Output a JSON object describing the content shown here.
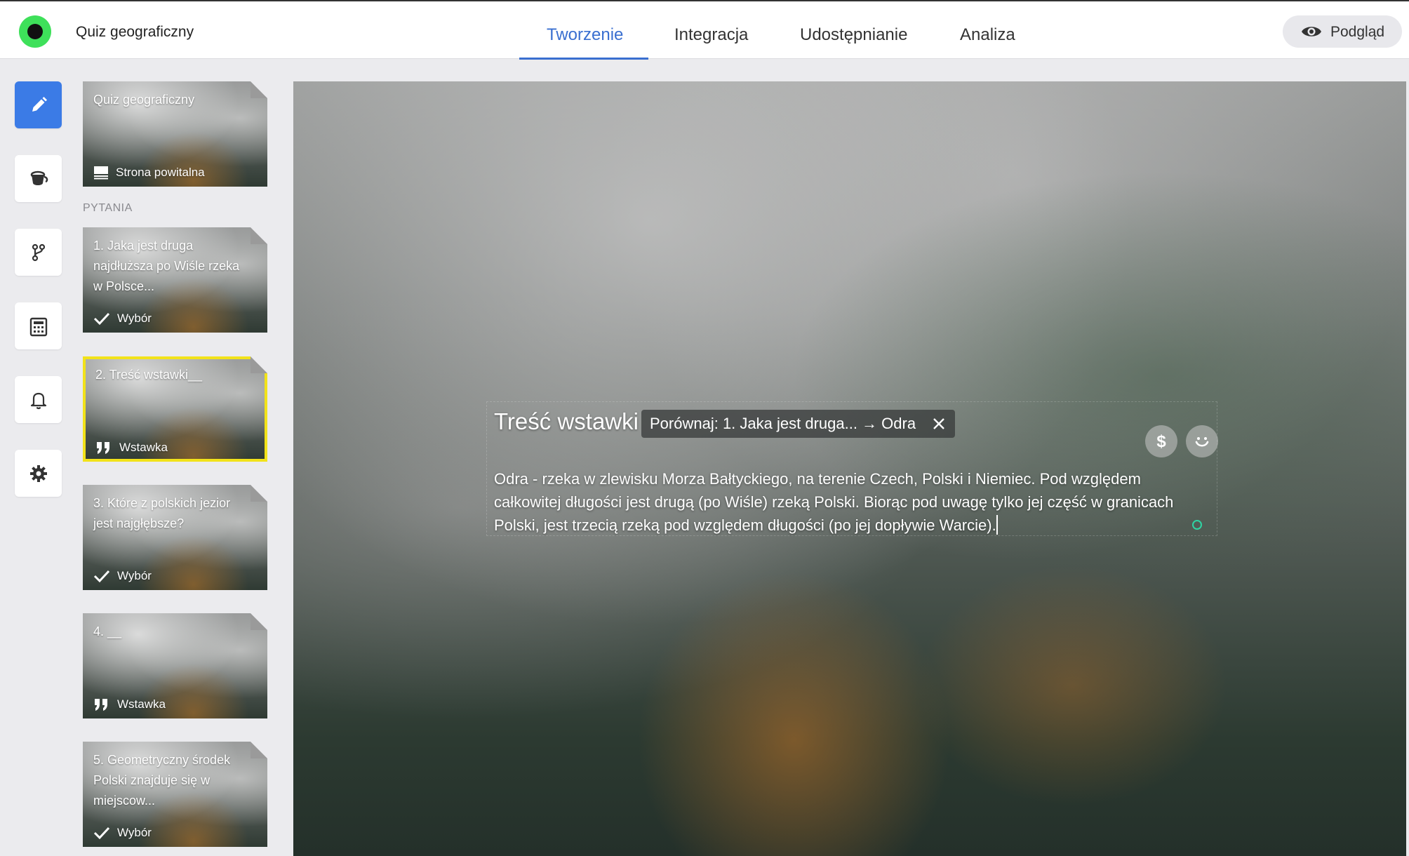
{
  "header": {
    "app_title": "Quiz geograficzny",
    "tabs": [
      {
        "label": "Tworzenie",
        "active": true
      },
      {
        "label": "Integracja",
        "active": false
      },
      {
        "label": "Udostępnianie",
        "active": false
      },
      {
        "label": "Analiza",
        "active": false
      }
    ],
    "preview_label": "Podgląd",
    "accent_color": "#3a6fd0"
  },
  "toolbar": {
    "tools": [
      {
        "icon": "pencil-icon",
        "active": true
      },
      {
        "icon": "paint-bucket-icon",
        "active": false
      },
      {
        "icon": "branch-icon",
        "active": false
      },
      {
        "icon": "calculator-icon",
        "active": false
      },
      {
        "icon": "bell-icon",
        "active": false
      },
      {
        "icon": "gear-icon",
        "active": false
      }
    ]
  },
  "slides": {
    "welcome": {
      "title": "Quiz geograficzny",
      "type": "Strona powitalna",
      "icon": "welcome-screen-icon"
    },
    "section_label": "PYTANIA",
    "items": [
      {
        "title": "1. Jaka jest druga najdłuższa po Wiśle rzeka w Polsce...",
        "type": "Wybór",
        "icon": "checkmark-icon",
        "selected": false
      },
      {
        "title": "2. Treść wstawki__",
        "type": "Wstawka",
        "icon": "quote-icon",
        "selected": true
      },
      {
        "title": "3. Które z polskich jezior jest najgłębsze?",
        "type": "Wybór",
        "icon": "checkmark-icon",
        "selected": false
      },
      {
        "title": "4. __",
        "type": "Wstawka",
        "icon": "quote-icon",
        "selected": false
      },
      {
        "title": "5. Geometryczny środek Polski znajduje się w miejscow...",
        "type": "Wybór",
        "icon": "checkmark-icon",
        "selected": false
      }
    ],
    "selected_outline_color": "#f2e21a"
  },
  "editor": {
    "block_title": "Treść wstawki",
    "compare_chip": "Porównaj: 1. Jaka jest druga... → Odra",
    "body_text": "Odra - rzeka w zlewisku Morza Bałtyckiego, na terenie Czech, Polski i Niemiec. Pod względem całkowitej długości jest drugą (po Wiśle) rzeką Polski. Biorąc pod uwagę tylko jej część w granicach Polski, jest trzecią rzeką pod względem długości (po jej dopływie Warcie).",
    "action_icons": [
      "dollar-icon",
      "smiley-icon"
    ]
  }
}
